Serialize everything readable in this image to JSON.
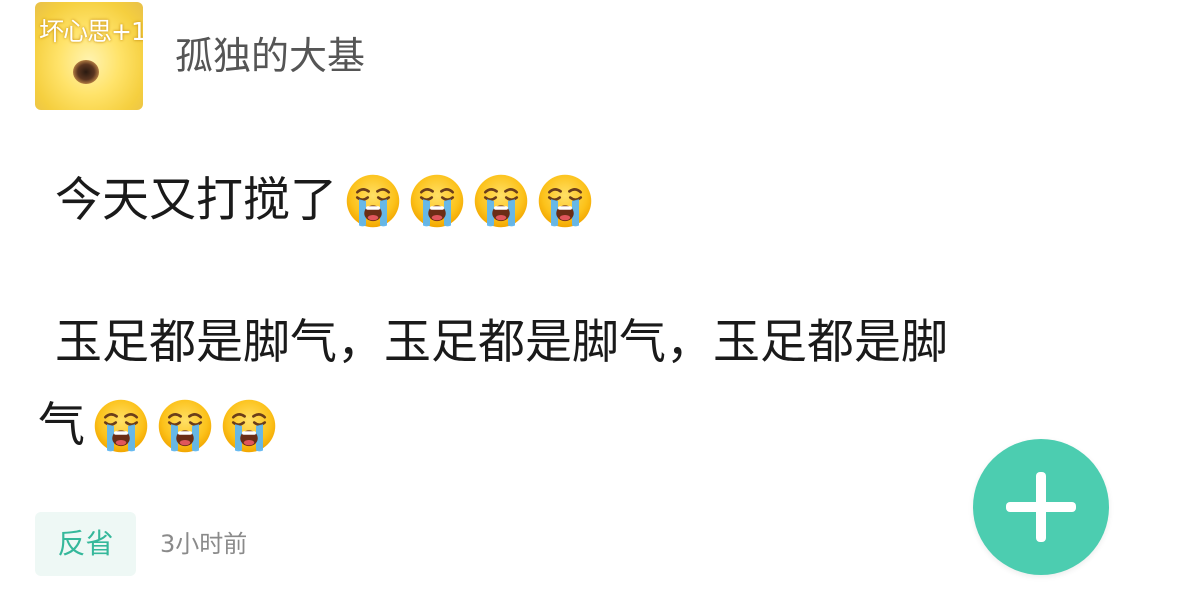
{
  "header": {
    "avatar_text": "坏心思+1",
    "username": "孤独的大基"
  },
  "post": {
    "line1_text": "今天又打搅了",
    "line1_emoji_count": 4,
    "line2_text": "玉足都是脚气，玉足都是脚气，玉足都是脚",
    "line3_text": "气",
    "line3_emoji_count": 3,
    "emoji_name": "loudly-crying-face"
  },
  "footer": {
    "tag_label": "反省",
    "timestamp": "3小时前"
  },
  "fab": {
    "icon": "plus-icon"
  },
  "colors": {
    "accent": "#4ccdb0",
    "tag_text": "#35b89b",
    "tag_bg": "#eef8f5",
    "username": "#555555",
    "body_text": "#1a1a1a",
    "timestamp": "#8a8a8a"
  }
}
